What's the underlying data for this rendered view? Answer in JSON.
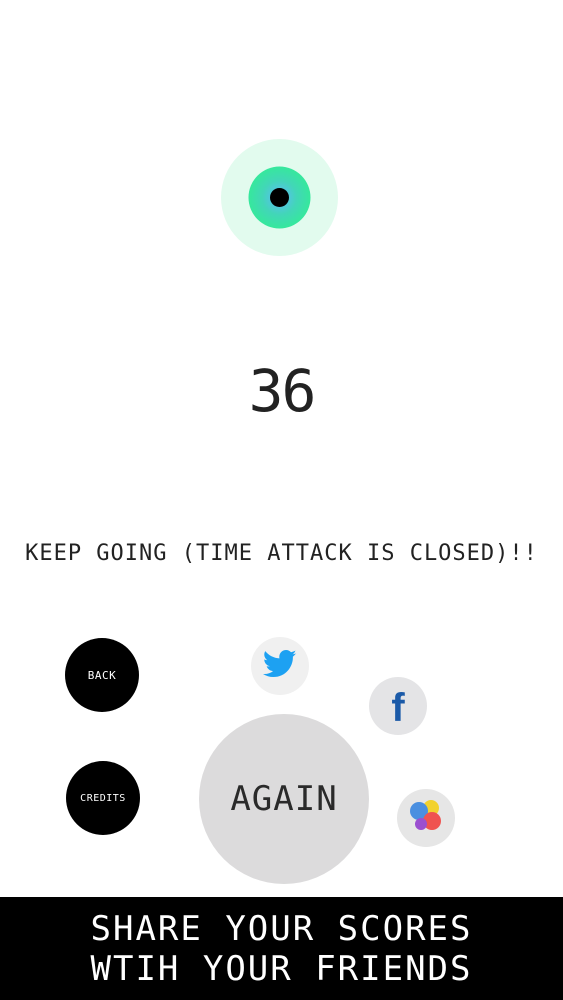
{
  "game": {
    "score": "36",
    "message": "KEEP GOING (TIME ATTACK IS CLOSED)!!"
  },
  "buttons": {
    "back_label": "BACK",
    "credits_label": "CREDITS",
    "again_label": "AGAIN"
  },
  "social": {
    "twitter_icon": "twitter-bird-icon",
    "facebook_icon": "facebook-f-icon",
    "gamecenter_icon": "game-center-bubbles-icon",
    "facebook_glyph": "f"
  },
  "banner": {
    "line1": "SHARE YOUR SCORES",
    "line2": "WTIH YOUR FRIENDS"
  },
  "colors": {
    "logo_outer": "#e2fbee",
    "logo_mid": "#34e8a1",
    "logo_inner": "#000000",
    "twitter_blue": "#1da1f2",
    "facebook_blue": "#1b5aa8",
    "again_gray": "#dcdbdc",
    "banner_black": "#000000"
  }
}
